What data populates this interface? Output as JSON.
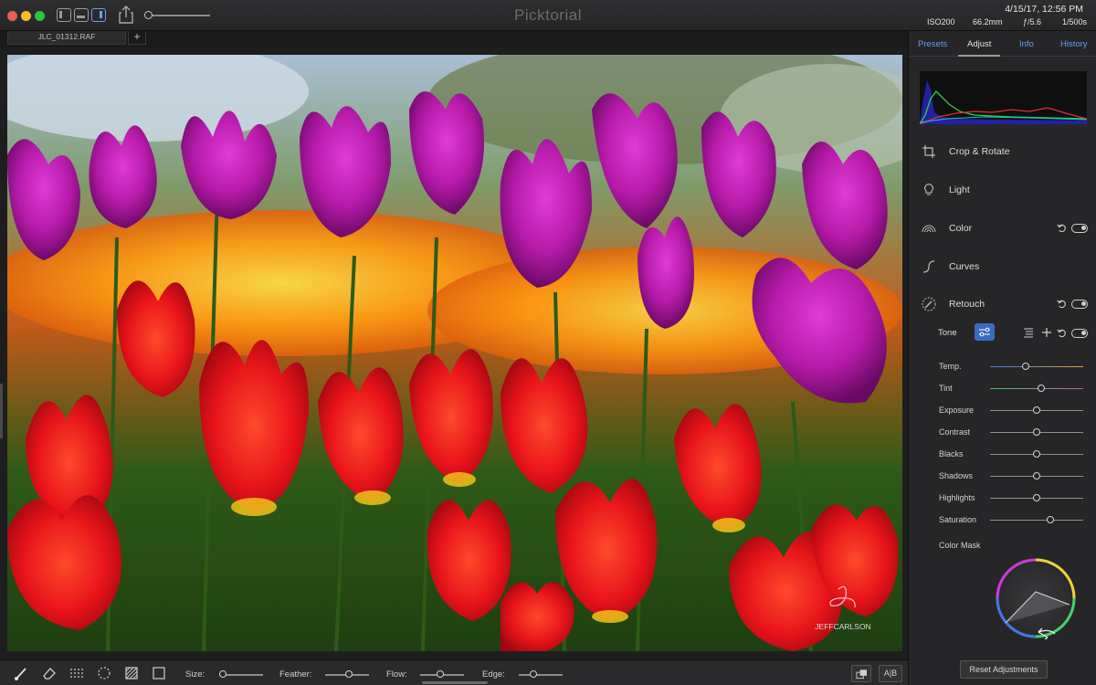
{
  "app": {
    "title": "Picktorial"
  },
  "meta": {
    "date": "4/15/17, 12:56 PM",
    "iso": "ISO200",
    "focal": "66.2mm",
    "aperture": "ƒ/5.6",
    "shutter": "1/500s"
  },
  "file_tab": {
    "name": "JLC_01312.RAF",
    "add_label": "+"
  },
  "watermark": {
    "text": "JEFFCARLSON"
  },
  "panel": {
    "tabs": [
      {
        "label": "Presets",
        "active": false
      },
      {
        "label": "Adjust",
        "active": true
      },
      {
        "label": "Info",
        "active": false
      },
      {
        "label": "History",
        "active": false
      }
    ],
    "sections": [
      {
        "label": "Crop & Rotate",
        "icon": "crop-icon"
      },
      {
        "label": "Light",
        "icon": "bulb-icon"
      },
      {
        "label": "Color",
        "icon": "rainbow-icon"
      },
      {
        "label": "Curves",
        "icon": "curve-icon"
      },
      {
        "label": "Retouch",
        "icon": "brush-icon"
      }
    ],
    "tone_label": "Tone",
    "adjustments": [
      {
        "label": "Temp.",
        "value": 0.38
      },
      {
        "label": "Tint",
        "value": 0.55
      },
      {
        "label": "Exposure",
        "value": 0.5
      },
      {
        "label": "Contrast",
        "value": 0.5
      },
      {
        "label": "Blacks",
        "value": 0.5
      },
      {
        "label": "Shadows",
        "value": 0.5
      },
      {
        "label": "Highlights",
        "value": 0.5
      },
      {
        "label": "Saturation",
        "value": 0.65
      }
    ],
    "color_mask_label": "Color Mask",
    "reset_label": "Reset Adjustments"
  },
  "bottom_toolbar": {
    "size_label": "Size:",
    "feather_label": "Feather:",
    "flow_label": "Flow:",
    "edge_label": "Edge:",
    "size_value": 0.0,
    "feather_value": 0.55,
    "flow_value": 0.45,
    "edge_value": 0.3,
    "compare_label": "A|B"
  }
}
